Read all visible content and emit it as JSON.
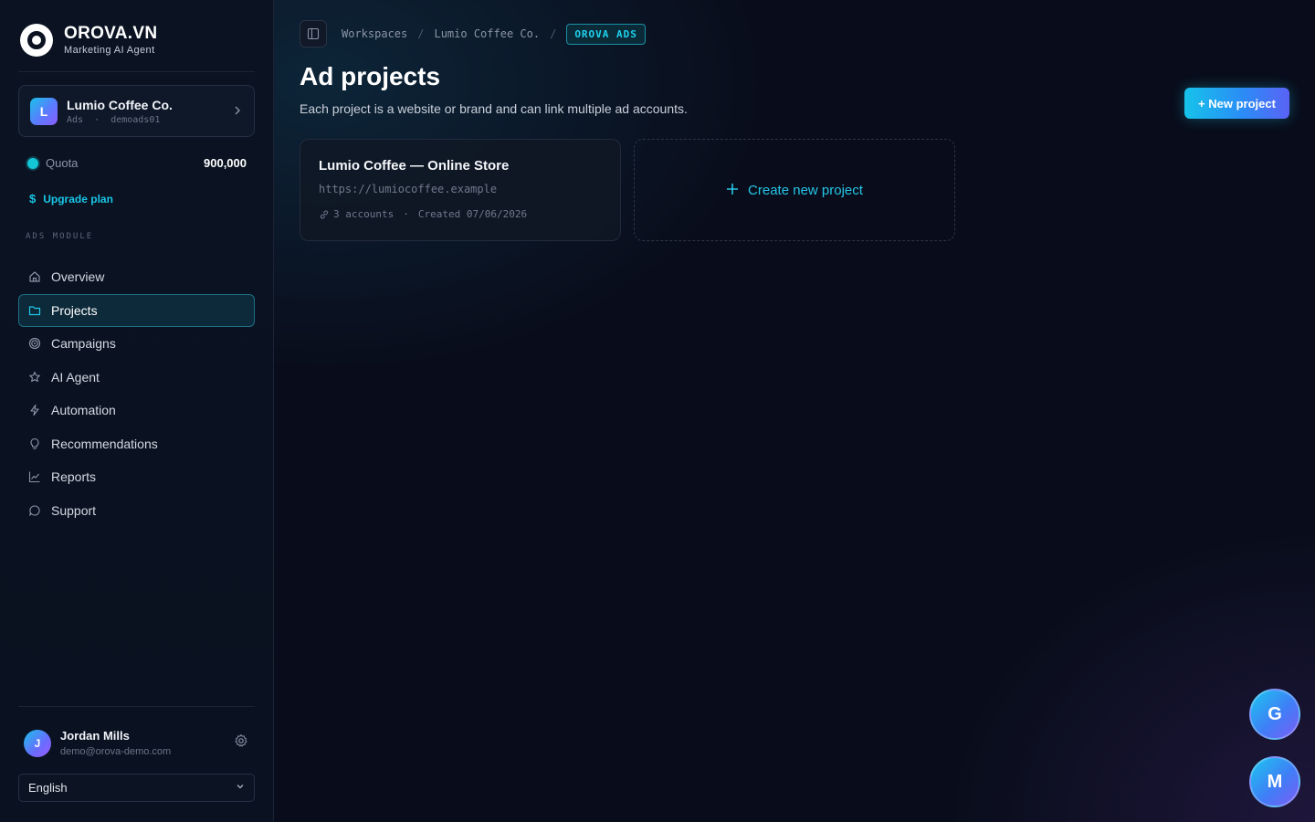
{
  "brand": {
    "name": "OROVA.VN",
    "tagline": "Marketing AI Agent"
  },
  "workspace": {
    "initial": "L",
    "name": "Lumio Coffee Co.",
    "module": "Ads",
    "account": "demoads01"
  },
  "quota": {
    "label": "Quota",
    "value": "900,000"
  },
  "upgrade": {
    "icon": "$",
    "label": "Upgrade plan"
  },
  "sidebar": {
    "section_label": "ADS MODULE",
    "items": [
      {
        "label": "Overview",
        "icon": "home-icon",
        "active": false
      },
      {
        "label": "Projects",
        "icon": "folder-icon",
        "active": true
      },
      {
        "label": "Campaigns",
        "icon": "target-icon",
        "active": false
      },
      {
        "label": "AI Agent",
        "icon": "star-icon",
        "active": false
      },
      {
        "label": "Automation",
        "icon": "lightning-icon",
        "active": false
      },
      {
        "label": "Recommendations",
        "icon": "lightbulb-icon",
        "active": false
      },
      {
        "label": "Reports",
        "icon": "chart-icon",
        "active": false
      },
      {
        "label": "Support",
        "icon": "chat-icon",
        "active": false
      }
    ]
  },
  "user": {
    "initial": "J",
    "name": "Jordan Mills",
    "email": "demo@orova-demo.com"
  },
  "language": {
    "selected": "English"
  },
  "breadcrumb": {
    "items": [
      "Workspaces",
      "Lumio Coffee Co."
    ],
    "separator": "/",
    "badge": "OROVA ADS"
  },
  "page": {
    "title": "Ad projects",
    "description": "Each project is a website or brand and can link multiple ad accounts.",
    "new_button": "+ New project"
  },
  "projects": [
    {
      "name": "Lumio Coffee — Online Store",
      "url": "https://lumiocoffee.example",
      "accounts": "3 accounts",
      "created": "Created 07/06/2026"
    }
  ],
  "create_card": {
    "label": "Create new project"
  },
  "floating_buttons": {
    "g": "G",
    "m": "M"
  },
  "colors": {
    "accent": "#19c6e6",
    "background": "#090d1b",
    "sidebar": "#0b1322"
  }
}
